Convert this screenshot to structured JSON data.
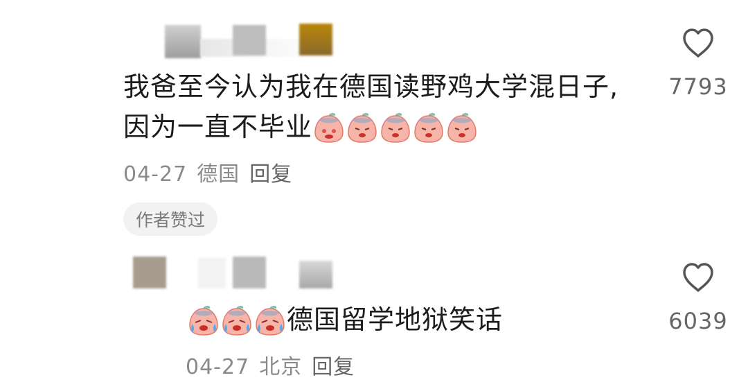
{
  "comments": [
    {
      "text_line1": "我爸至今认为我在德国读野鸡大学混日子,",
      "text_line2": "因为一直不毕业",
      "date": "04-27",
      "location": "德国",
      "reply_label": "回复",
      "badge": "作者赞过",
      "like_count": "7793",
      "emojis": [
        "blushing-peach-emoji",
        "sad-peach-emoji",
        "sad-peach-emoji",
        "sad-peach-emoji",
        "sad-peach-emoji"
      ]
    },
    {
      "text": "德国留学地狱笑话",
      "date": "04-27",
      "location": "北京",
      "reply_label": "回复",
      "like_count": "6039",
      "emojis": [
        "crying-peach-emoji",
        "crying-peach-emoji",
        "crying-peach-emoji"
      ]
    }
  ],
  "icons": {
    "like": "heart-outline-icon"
  },
  "colors": {
    "text": "#1c1c1c",
    "meta": "#8a8a8a",
    "badge_bg": "#f2f2f2",
    "emoji_pink": "#f4a9a0"
  }
}
